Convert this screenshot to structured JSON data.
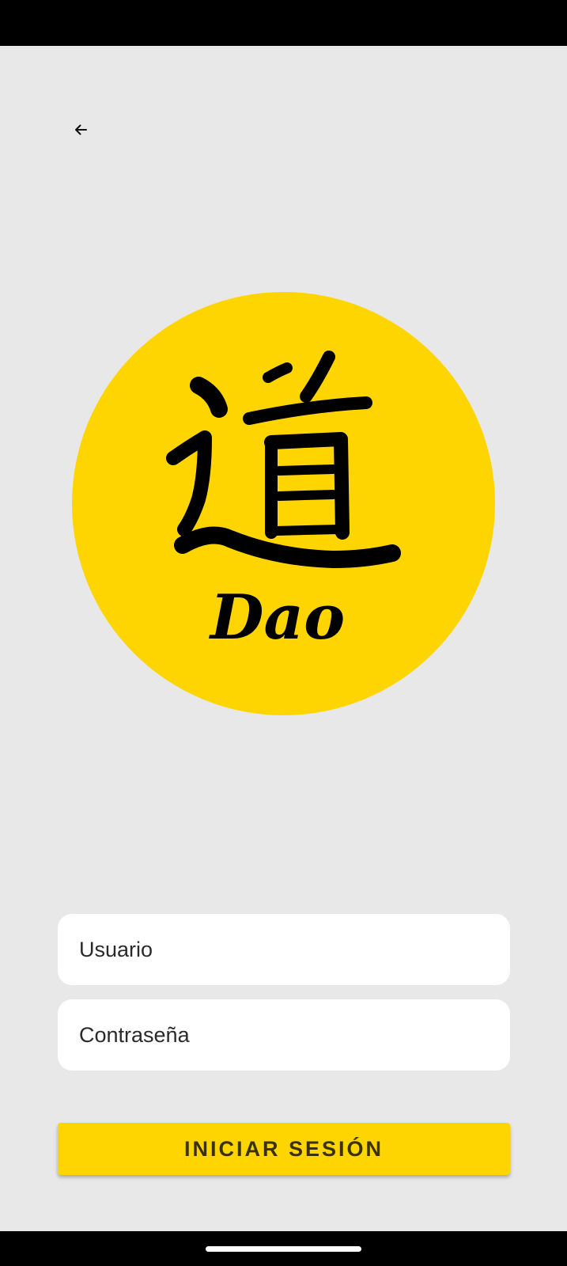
{
  "back_button": {
    "icon": "arrow-left-icon"
  },
  "logo": {
    "circle_color": "#fed500",
    "glyph": "道",
    "wordmark": "Dao"
  },
  "form": {
    "username_placeholder": "Usuario",
    "password_placeholder": "Contraseña",
    "submit_label": "INICIAR SESIÓN"
  },
  "colors": {
    "background": "#e8e8e8",
    "accent": "#fed500",
    "field": "#ffffff",
    "system_bars": "#000000"
  }
}
